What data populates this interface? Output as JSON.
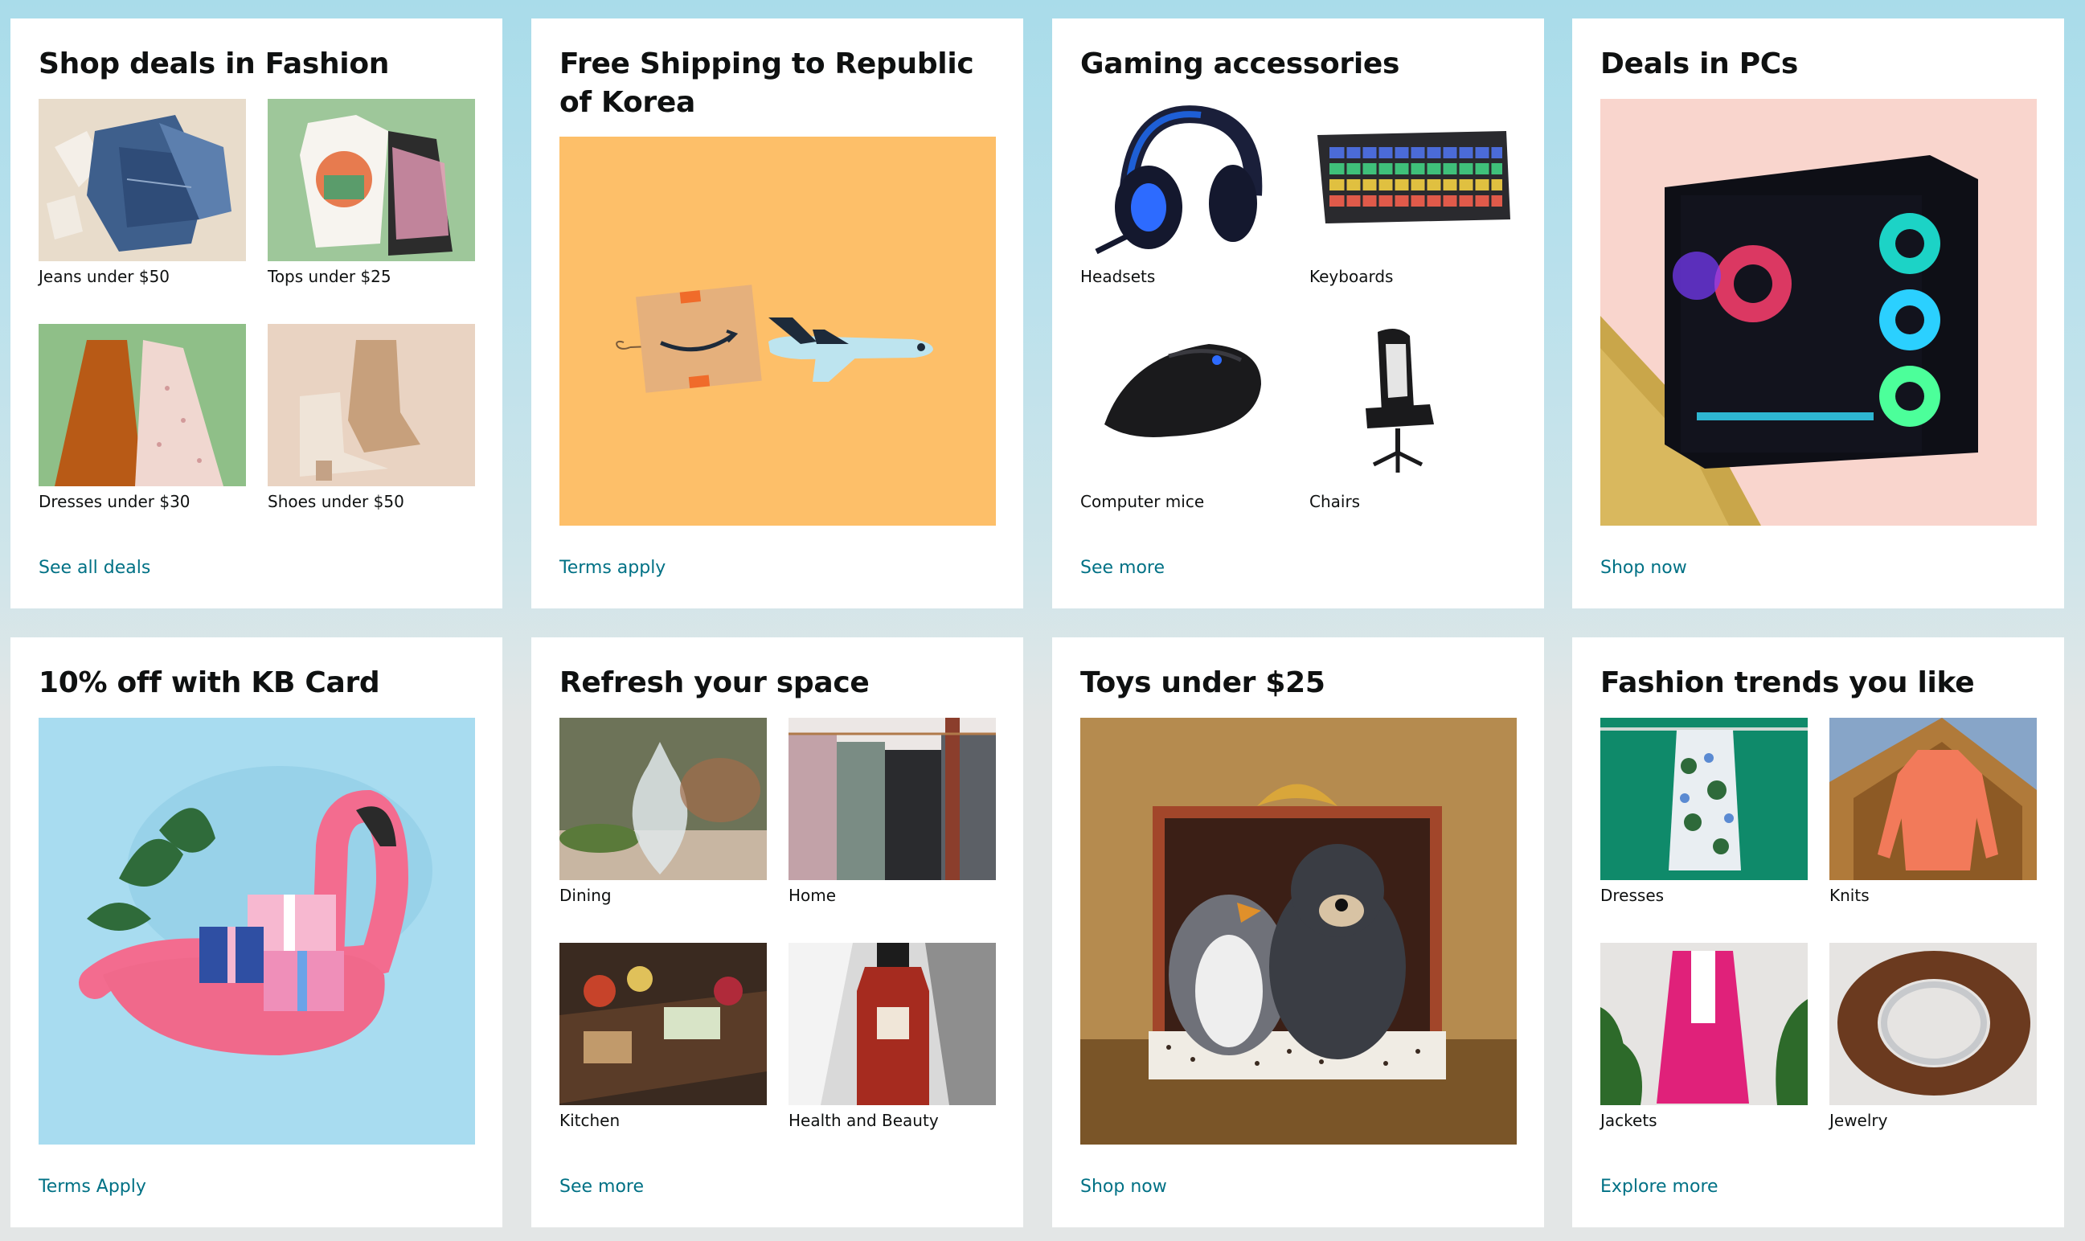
{
  "cards": [
    {
      "title": "Shop deals in Fashion",
      "items": [
        {
          "label": "Jeans under $50",
          "icon": "jeans-image"
        },
        {
          "label": "Tops under $25",
          "icon": "tops-image"
        },
        {
          "label": "Dresses under $30",
          "icon": "dresses-image"
        },
        {
          "label": "Shoes under $50",
          "icon": "shoes-image"
        }
      ],
      "link": "See all deals"
    },
    {
      "title": "Free Shipping to Republic of Korea",
      "link": "Terms apply"
    },
    {
      "title": "Gaming accessories",
      "items": [
        {
          "label": "Headsets",
          "icon": "headset-image"
        },
        {
          "label": "Keyboards",
          "icon": "keyboard-image"
        },
        {
          "label": "Computer mice",
          "icon": "mouse-image"
        },
        {
          "label": "Chairs",
          "icon": "chair-image"
        }
      ],
      "link": "See more"
    },
    {
      "title": "Deals in PCs",
      "link": "Shop now"
    },
    {
      "title": "10% off with KB Card",
      "link": "Terms Apply"
    },
    {
      "title": "Refresh your space",
      "items": [
        {
          "label": "Dining",
          "icon": "dining-image"
        },
        {
          "label": "Home",
          "icon": "home-image"
        },
        {
          "label": "Kitchen",
          "icon": "kitchen-image"
        },
        {
          "label": "Health and Beauty",
          "icon": "beauty-image"
        }
      ],
      "link": "See more"
    },
    {
      "title": "Toys under $25",
      "link": "Shop now"
    },
    {
      "title": "Fashion trends you like",
      "items": [
        {
          "label": "Dresses",
          "icon": "dress-image"
        },
        {
          "label": "Knits",
          "icon": "knits-image"
        },
        {
          "label": "Jackets",
          "icon": "jacket-image"
        },
        {
          "label": "Jewelry",
          "icon": "jewelry-image"
        }
      ],
      "link": "Explore more"
    }
  ],
  "colors": {
    "link": "#007185",
    "text": "#0f1111",
    "shipping_bg": "#fdbf69",
    "kb_bg": "#a8dcf0",
    "pc_bg": "#f9d5cd"
  }
}
